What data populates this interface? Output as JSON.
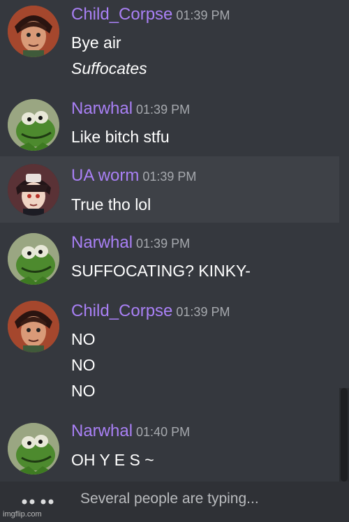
{
  "messages": [
    {
      "username": "Child_Corpse",
      "time": "01:39 PM",
      "avatar": "child-corpse-avatar",
      "lines": [
        {
          "text": "Bye air",
          "italic": false
        },
        {
          "text": "Suffocates",
          "italic": true
        }
      ]
    },
    {
      "username": "Narwhal",
      "time": "01:39 PM",
      "avatar": "kermit-avatar",
      "lines": [
        {
          "text": "Like bitch stfu",
          "italic": false
        }
      ]
    },
    {
      "username": "UA worm",
      "time": "01:39 PM",
      "avatar": "ua-worm-avatar",
      "highlighted": true,
      "lines": [
        {
          "text": "True tho lol",
          "italic": false
        }
      ]
    },
    {
      "username": "Narwhal",
      "time": "01:39 PM",
      "avatar": "kermit-avatar",
      "lines": [
        {
          "text": "SUFFOCATING? KINKY-",
          "italic": false
        }
      ]
    },
    {
      "username": "Child_Corpse",
      "time": "01:39 PM",
      "avatar": "child-corpse-avatar",
      "lines": [
        {
          "text": "NO",
          "italic": false
        },
        {
          "text": "NO",
          "italic": false
        },
        {
          "text": "NO",
          "italic": false
        }
      ]
    },
    {
      "username": "Narwhal",
      "time": "01:40 PM",
      "avatar": "kermit-avatar",
      "lines": [
        {
          "text": "OH Y E S ~",
          "italic": false
        }
      ]
    }
  ],
  "typing_indicator": {
    "text": "Several people are typing...",
    "icon": "typing-dots-icon"
  },
  "watermark": "imgflip.com",
  "colors": {
    "background": "#35383e",
    "highlight": "#3e4147",
    "username": "#a980f5",
    "timestamp": "#a6a9ae",
    "message_text": "#ffffff",
    "typing_bar": "#2f3136"
  }
}
